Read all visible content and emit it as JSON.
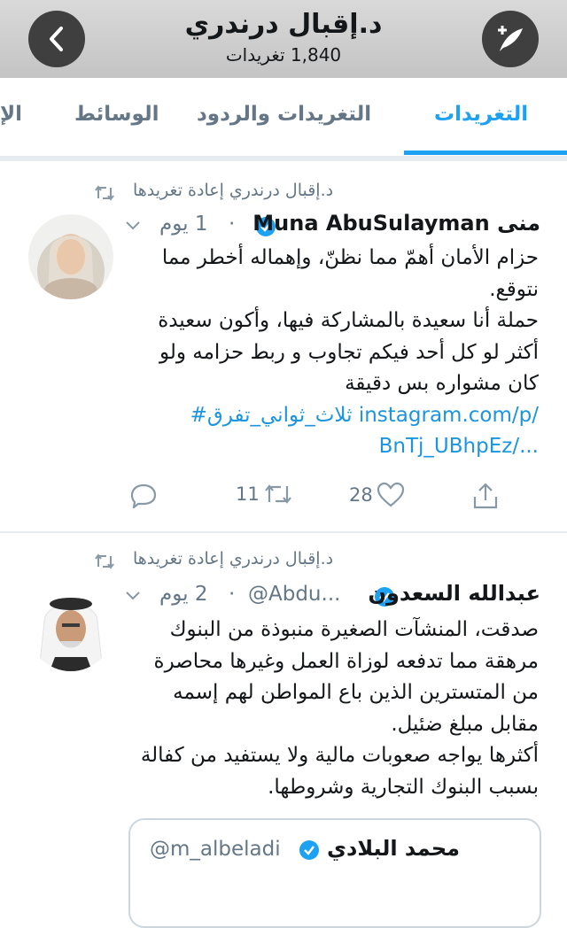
{
  "header": {
    "title": "د.إقبال درندري",
    "subtitle": "1,840 تغريدات",
    "back_icon": "chevron-left-icon",
    "compose_icon": "compose-tweet-icon"
  },
  "tabs": [
    {
      "label": "التغريدات",
      "active": true
    },
    {
      "label": "التغريدات والردود",
      "active": false
    },
    {
      "label": "الوسائط",
      "active": false
    },
    {
      "label": "الإ",
      "active": false
    }
  ],
  "colors": {
    "accent": "#1da1f2",
    "muted": "#657786",
    "link": "#1b95e0",
    "header_bg": "#cfcfcf"
  },
  "tweets": [
    {
      "retweet_label": "د.إقبال درندري إعادة تغريدها",
      "display_name": "Muna AbuSulayman منى",
      "handle": "",
      "time": "1 يوم",
      "dot": "·",
      "lines": [
        "حزام الأمان أهمّ مما نظنّ، وإهماله أخطر مما نتوقع.",
        "حملة أنا سعيدة بالمشاركة فيها، وأكون سعيدة أكثر لو كل أحد فيكم تجاوب و ربط حزامه ولو كان مشواره بس دقيقة"
      ],
      "link_line_1": "#ثلاث_ثواني_تفرق instagram.com/p/",
      "link_line_2": "BnTj_UBhpEz/...",
      "retweets": "11",
      "likes": "28"
    },
    {
      "retweet_label": "د.إقبال درندري إعادة تغريدها",
      "display_name": "عبدالله السعدون",
      "handle": "@Abdu...",
      "time": "2 يوم",
      "dot": "·",
      "lines": [
        "صدقت، المنشآت الصغيرة منبوذة من البنوك مرهقة مما تدفعه لوزاة العمل وغيرها محاصرة من المتسترين الذين باع المواطن لهم إسمه مقابل مبلغ ضئيل.",
        "أكثرها يواجه صعوبات مالية  ولا يستفيد من كفالة بسبب البنوك التجارية وشروطها."
      ],
      "quote": {
        "display_name": "محمد البلادي",
        "handle": "@m_albeladi"
      }
    }
  ]
}
